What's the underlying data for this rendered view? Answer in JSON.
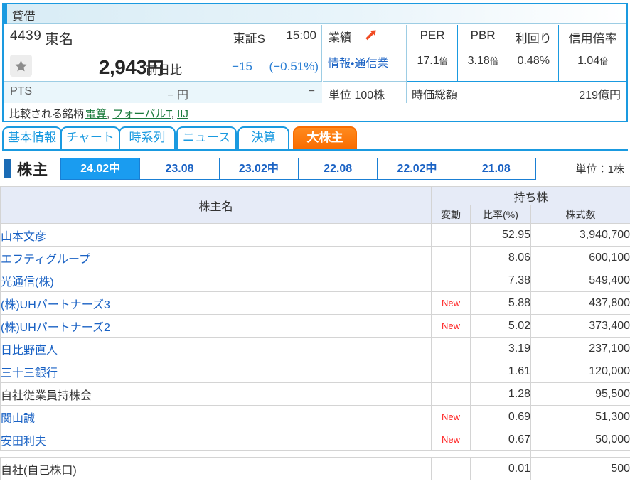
{
  "quote": {
    "panel_title": "貸借",
    "code": "4439",
    "name": "東名",
    "market": "東証S",
    "time": "15:00",
    "price": "2,943",
    "price_unit": "円",
    "prev_close_label": "前日比",
    "change": "−15",
    "change_pct": "(−0.51%)",
    "pts_label": "PTS",
    "pts_price": "− 円",
    "pts_change": "−",
    "star_icon": "favorite-star-icon",
    "performance_label": "業績",
    "performance_arrow_icon": "up-right-arrow-icon",
    "sector_link": "情報・通信業",
    "trade_unit": "単位 100株",
    "metrics": [
      {
        "name": "PER",
        "value": "17.1",
        "suffix": "倍"
      },
      {
        "name": "PBR",
        "value": "3.18",
        "suffix": "倍"
      },
      {
        "name": "利回り",
        "value": "0.48%",
        "suffix": ""
      },
      {
        "name": "信用倍率",
        "value": "1.04",
        "suffix": "倍"
      }
    ],
    "market_cap_label": "時価総額",
    "market_cap_value": "219億円",
    "compare_label": "比較される銘柄",
    "compare_links": [
      "電算",
      "フォーバルT",
      "IIJ"
    ],
    "accent_color": "#1a9ae0"
  },
  "main_tabs": [
    {
      "label": "基本情報",
      "active": false
    },
    {
      "label": "チャート",
      "active": false
    },
    {
      "label": "時系列",
      "active": false
    },
    {
      "label": "ニュース",
      "active": false
    },
    {
      "label": "決算",
      "active": false
    },
    {
      "label": "大株主",
      "active": true
    }
  ],
  "section": {
    "title": "株主",
    "unit_note": "単位：1株",
    "active_color": "#1a9cf0"
  },
  "period_tabs": [
    {
      "label": "24.02中",
      "active": true
    },
    {
      "label": "23.08",
      "active": false
    },
    {
      "label": "23.02中",
      "active": false
    },
    {
      "label": "22.08",
      "active": false
    },
    {
      "label": "22.02中",
      "active": false
    },
    {
      "label": "21.08",
      "active": false
    }
  ],
  "table": {
    "header_name": "株主名",
    "header_group": "持ち株",
    "header_delta": "変動",
    "header_ratio": "比率(%)",
    "header_shares": "株式数",
    "rows": [
      {
        "name": "山本文彦",
        "link": true,
        "delta": "",
        "ratio": "52.95",
        "shares": "3,940,700"
      },
      {
        "name": "エフティグループ",
        "link": true,
        "delta": "",
        "ratio": "8.06",
        "shares": "600,100"
      },
      {
        "name": "光通信(株)",
        "link": true,
        "delta": "",
        "ratio": "7.38",
        "shares": "549,400"
      },
      {
        "name": "(株)UHパートナーズ3",
        "link": true,
        "delta": "New",
        "ratio": "5.88",
        "shares": "437,800"
      },
      {
        "name": "(株)UHパートナーズ2",
        "link": true,
        "delta": "New",
        "ratio": "5.02",
        "shares": "373,400"
      },
      {
        "name": "日比野直人",
        "link": true,
        "delta": "",
        "ratio": "3.19",
        "shares": "237,100"
      },
      {
        "name": "三十三銀行",
        "link": true,
        "delta": "",
        "ratio": "1.61",
        "shares": "120,000"
      },
      {
        "name": "自社従業員持株会",
        "link": false,
        "delta": "",
        "ratio": "1.28",
        "shares": "95,500"
      },
      {
        "name": "関山誠",
        "link": true,
        "delta": "New",
        "ratio": "0.69",
        "shares": "51,300"
      },
      {
        "name": "安田利夫",
        "link": true,
        "delta": "New",
        "ratio": "0.67",
        "shares": "50,000"
      }
    ],
    "treasury_row": {
      "name": "自社(自己株口)",
      "link": false,
      "delta": "",
      "ratio": "0.01",
      "shares": "500"
    }
  }
}
